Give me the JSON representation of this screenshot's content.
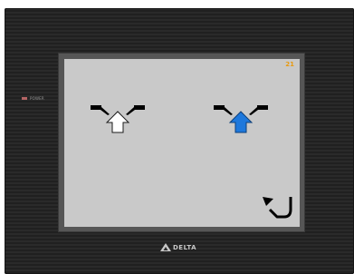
{
  "device": {
    "power_label": "POWER",
    "brand": "DELTA",
    "led_color": "#b46464"
  },
  "screen": {
    "page_number": "21",
    "background_color": "#c9c9c9",
    "page_number_color": "#e89a10"
  },
  "buttons": [
    {
      "name": "reed-up-button-white",
      "icon": "reed-arrow-up-icon",
      "arrow_color": "#ffffff",
      "state": "inactive"
    },
    {
      "name": "reed-up-button-blue",
      "icon": "reed-arrow-up-icon",
      "arrow_color": "#1e78dc",
      "state": "active"
    },
    {
      "name": "back-button",
      "icon": "return-arrow-icon"
    }
  ]
}
